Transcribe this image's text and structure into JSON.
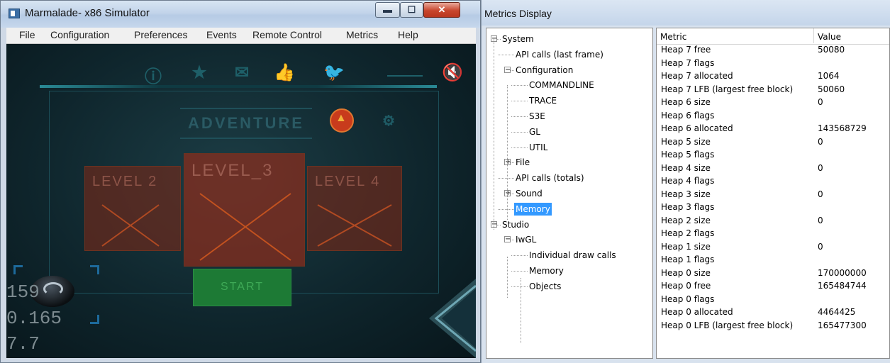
{
  "simulator": {
    "title": "Marmalade- x86 Simulator",
    "controls": {
      "minimize": "▬",
      "maximize": "☐",
      "close": "✕"
    },
    "menu": [
      "File",
      "Configuration",
      "Preferences",
      "Events",
      "Remote Control",
      "Metrics",
      "Help"
    ],
    "game": {
      "top_icons": [
        "info-icon",
        "star-icon",
        "mail-icon",
        "thumbs-up-icon",
        "twitter-icon",
        "mute-icon"
      ],
      "banner": "ADVENTURE",
      "levels": [
        {
          "label": "LEVEL 2"
        },
        {
          "label": "LEVEL_3"
        },
        {
          "label": "LEVEL 4"
        }
      ],
      "start_label": "START",
      "stats": [
        "159",
        "0.165",
        "7.7"
      ]
    }
  },
  "metrics": {
    "title": "Metrics Display",
    "tree": [
      {
        "label": "System",
        "expander": "−",
        "depth": 0
      },
      {
        "label": "API calls (last frame)",
        "expander": "",
        "depth": 1
      },
      {
        "label": "Configuration",
        "expander": "−",
        "depth": 1
      },
      {
        "label": "COMMANDLINE",
        "expander": "",
        "depth": 2
      },
      {
        "label": "TRACE",
        "expander": "",
        "depth": 2
      },
      {
        "label": "S3E",
        "expander": "",
        "depth": 2
      },
      {
        "label": "GL",
        "expander": "",
        "depth": 2
      },
      {
        "label": "UTIL",
        "expander": "",
        "depth": 2
      },
      {
        "label": "File",
        "expander": "+",
        "depth": 1
      },
      {
        "label": "API calls (totals)",
        "expander": "",
        "depth": 1
      },
      {
        "label": "Sound",
        "expander": "+",
        "depth": 1
      },
      {
        "label": "Memory",
        "expander": "",
        "depth": 1,
        "selected": true
      },
      {
        "label": "Studio",
        "expander": "−",
        "depth": 0
      },
      {
        "label": "IwGL",
        "expander": "−",
        "depth": 1
      },
      {
        "label": "Individual draw calls",
        "expander": "",
        "depth": 2
      },
      {
        "label": "Memory",
        "expander": "",
        "depth": 2
      },
      {
        "label": "Objects",
        "expander": "",
        "depth": 2
      }
    ],
    "columns": {
      "metric": "Metric",
      "value": "Value"
    },
    "rows": [
      {
        "metric": "Heap 7 free",
        "value": "50080"
      },
      {
        "metric": "Heap 7 flags",
        "value": ""
      },
      {
        "metric": "Heap 7 allocated",
        "value": "1064"
      },
      {
        "metric": "Heap 7 LFB (largest free block)",
        "value": "50060"
      },
      {
        "metric": "Heap 6 size",
        "value": "0"
      },
      {
        "metric": "Heap 6 flags",
        "value": ""
      },
      {
        "metric": "Heap 6 allocated",
        "value": "143568729"
      },
      {
        "metric": "Heap 5 size",
        "value": "0"
      },
      {
        "metric": "Heap 5 flags",
        "value": ""
      },
      {
        "metric": "Heap 4 size",
        "value": "0"
      },
      {
        "metric": "Heap 4 flags",
        "value": ""
      },
      {
        "metric": "Heap 3 size",
        "value": "0"
      },
      {
        "metric": "Heap 3 flags",
        "value": ""
      },
      {
        "metric": "Heap 2 size",
        "value": "0"
      },
      {
        "metric": "Heap 2 flags",
        "value": ""
      },
      {
        "metric": "Heap 1 size",
        "value": "0"
      },
      {
        "metric": "Heap 1 flags",
        "value": ""
      },
      {
        "metric": "Heap 0 size",
        "value": "170000000"
      },
      {
        "metric": "Heap 0 free",
        "value": "165484744"
      },
      {
        "metric": "Heap 0 flags",
        "value": ""
      },
      {
        "metric": "Heap 0 allocated",
        "value": "4464425"
      },
      {
        "metric": "Heap 0 LFB (largest free block)",
        "value": "165477300"
      }
    ]
  },
  "colors": {
    "selection": "#3399ff",
    "start_button": "#1d7a35",
    "level_tile": "#782819",
    "game_background": "#0f262d"
  }
}
